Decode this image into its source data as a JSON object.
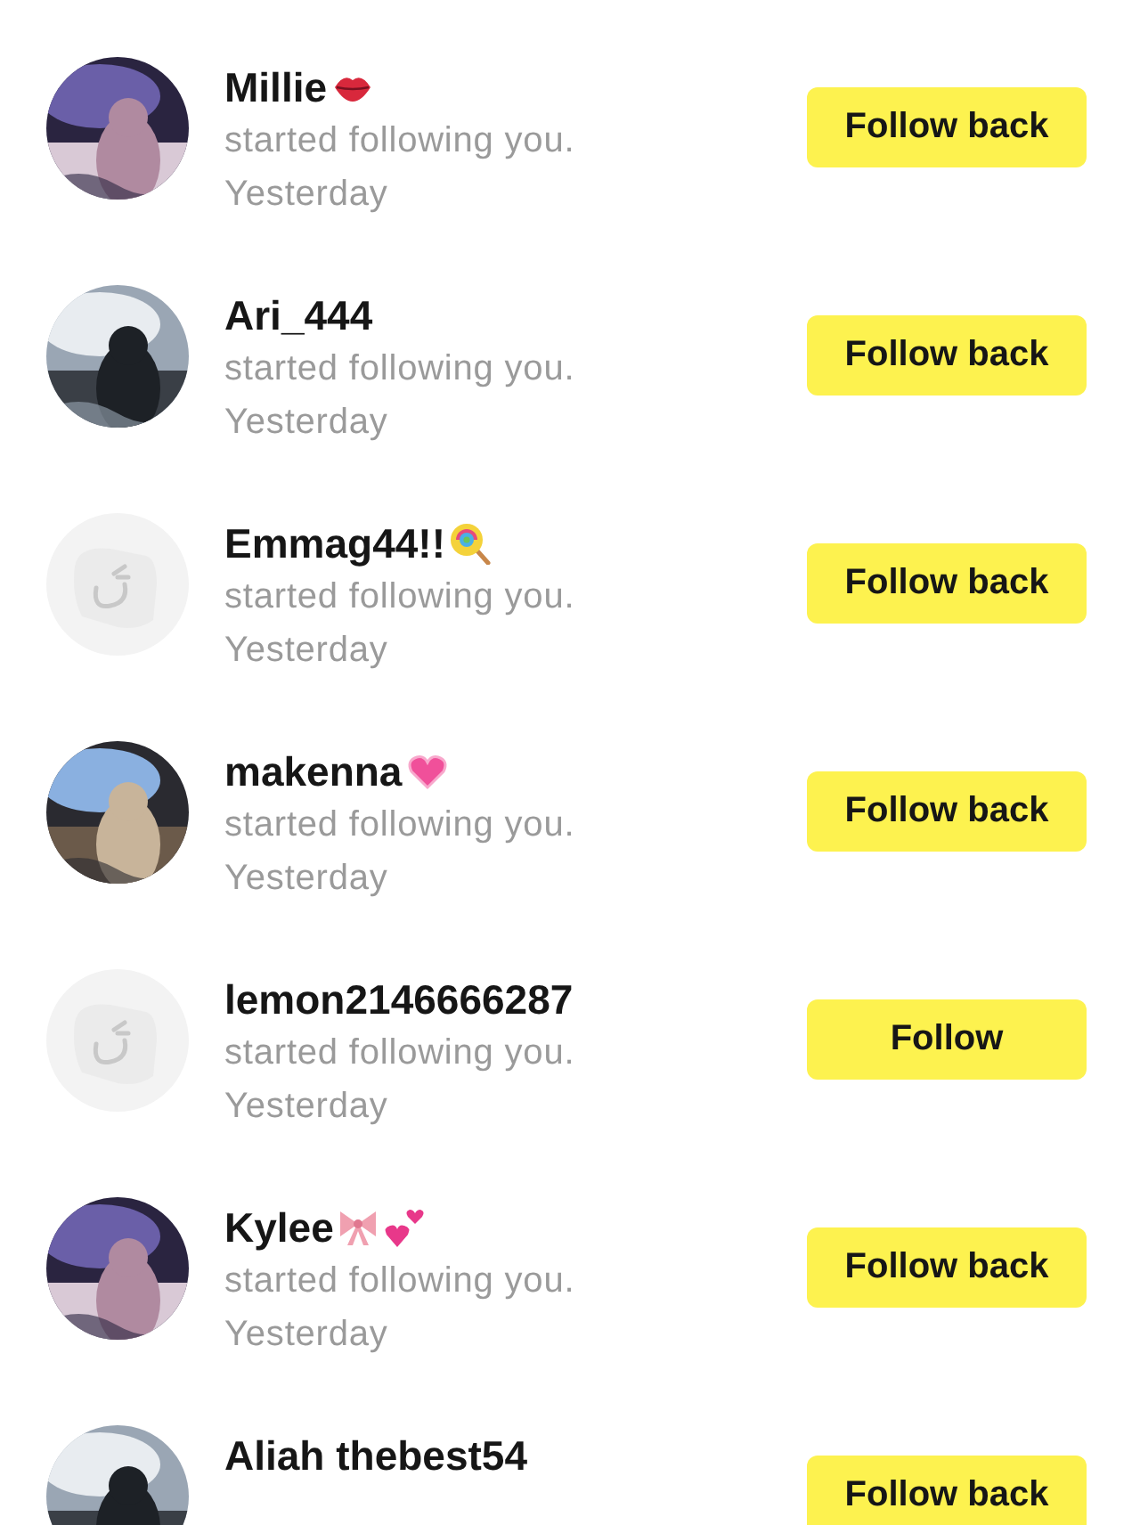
{
  "notifications": [
    {
      "avatar": {
        "kind": "picture"
      },
      "name": "Millie",
      "badges": [
        {
          "kind": "lips"
        }
      ],
      "message": "started following you.",
      "time": "Yesterday",
      "button": "Follow back"
    },
    {
      "avatar": {
        "kind": "picture"
      },
      "name": "Ari_444",
      "message": "started following you.",
      "time": "Yesterday",
      "button": "Follow back"
    },
    {
      "avatar": {
        "kind": "default"
      },
      "name": "Emmag44!!",
      "badges": [
        {
          "kind": "lollipop"
        }
      ],
      "message": "started following you.",
      "time": "Yesterday",
      "button": "Follow back"
    },
    {
      "avatar": {
        "kind": "picture"
      },
      "name": "makenna",
      "badges": [
        {
          "kind": "heart"
        }
      ],
      "message": "started following you.",
      "time": "Yesterday",
      "button": "Follow back"
    },
    {
      "avatar": {
        "kind": "default"
      },
      "name": "lemon2146666287",
      "message": "started following you.",
      "time": "Yesterday",
      "button": "Follow"
    },
    {
      "avatar": {
        "kind": "picture"
      },
      "name": "Kylee",
      "badges": [
        {
          "kind": "bow"
        },
        {
          "kind": "hearts"
        }
      ],
      "message": "started following you.",
      "time": "Yesterday",
      "button": "Follow back"
    },
    {
      "avatar": {
        "kind": "picture"
      },
      "name": "Aliah thebest54",
      "button": "Follow back"
    }
  ]
}
